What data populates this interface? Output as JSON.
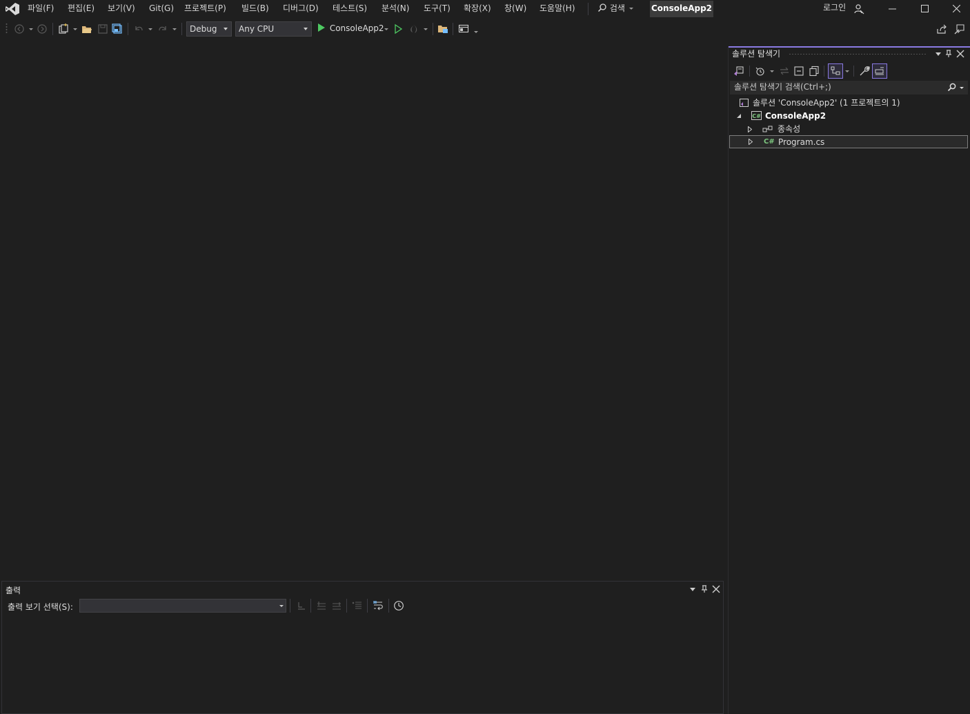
{
  "menu": {
    "items": [
      "파일(F)",
      "편집(E)",
      "보기(V)",
      "Git(G)",
      "프로젝트(P)",
      "빌드(B)",
      "디버그(D)",
      "테스트(S)",
      "분석(N)",
      "도구(T)",
      "확장(X)",
      "창(W)",
      "도움말(H)"
    ],
    "search_label": "검색",
    "project_badge": "ConsoleApp2",
    "login_label": "로그인"
  },
  "toolbar": {
    "config_value": "Debug",
    "platform_value": "Any CPU",
    "run_target_label": "ConsoleApp2"
  },
  "solution_explorer": {
    "title": "솔루션 탐색기",
    "search_placeholder": "솔루션 탐색기 검색(Ctrl+;)",
    "tree": {
      "solution_label": "솔루션 'ConsoleApp2' (1 프로젝트의 1)",
      "project_label": "ConsoleApp2",
      "dependencies_label": "종속성",
      "program_label": "Program.cs",
      "cs_glyph": "C#"
    }
  },
  "output": {
    "title": "출력",
    "source_label": "출력 보기 선택(S):",
    "source_value": ""
  },
  "colors": {
    "background": "#1f1f1f",
    "accent": "#8a7ae3",
    "run_green": "#4ec962",
    "badge_bg": "#3c3c3c"
  },
  "icons": [
    "vs-logo-icon",
    "search-icon",
    "person-icon",
    "minimize-icon",
    "maximize-icon",
    "close-icon",
    "back-icon",
    "forward-icon",
    "new-project-icon",
    "open-folder-icon",
    "save-icon",
    "save-all-icon",
    "undo-icon",
    "redo-icon",
    "play-icon",
    "play-outline-icon",
    "hot-reload-icon",
    "browse-icon",
    "layout-icon",
    "share-icon",
    "feedback-icon",
    "pin-icon",
    "dropdown-arrow-icon",
    "home-icon",
    "history-icon",
    "sync-icon",
    "collapse-all-icon",
    "copy-icon",
    "view-switch-icon",
    "wrench-icon",
    "preview-icon",
    "clock-icon",
    "word-wrap-icon"
  ]
}
